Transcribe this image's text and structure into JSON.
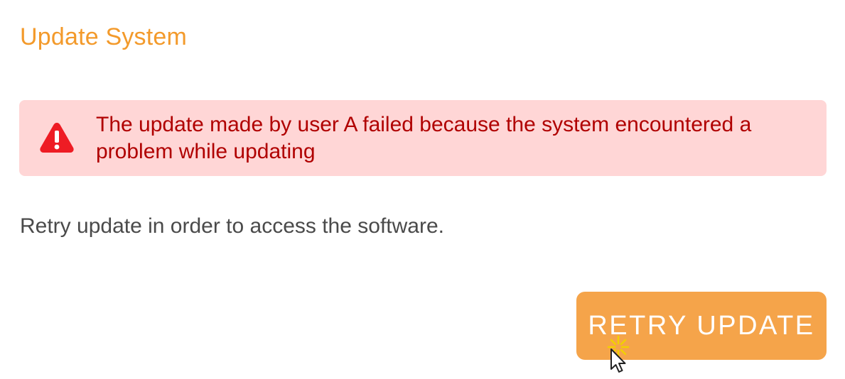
{
  "dialog": {
    "title": "Update System",
    "accent_color": "#f39a2b"
  },
  "alert": {
    "icon": "warning-triangle-icon",
    "message": "The update made by user A failed because the system encountered a problem while updating",
    "background_color": "#ffd6d6",
    "text_color": "#b00000"
  },
  "body": {
    "message": "Retry update in order to access the software."
  },
  "actions": {
    "retry_label": "RETRY UPDATE",
    "retry_color": "#f5a44a"
  },
  "cursor": {
    "icon": "mouse-pointer-icon"
  }
}
